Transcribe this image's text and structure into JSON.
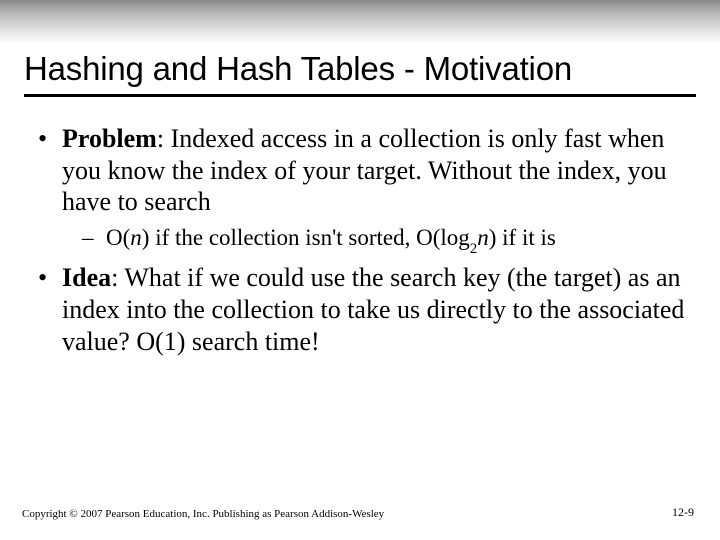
{
  "title": "Hashing and Hash Tables - Motivation",
  "bullets": {
    "b1": {
      "label": "Problem",
      "text": ": Indexed access in a collection is only fast when you know the index of your target. Without the index, you have to search"
    },
    "b1a": {
      "pre": "O(",
      "n1": "n",
      "mid": ") if the collection isn't sorted, O(log",
      "sub": "2",
      "n2": "n",
      "post": ") if it is"
    },
    "b2": {
      "label": "Idea",
      "text": ": What if we could use the search key (the target) as an index into the collection to take us directly to the associated value? O(1) search time!"
    }
  },
  "footer": "Copyright © 2007 Pearson Education, Inc. Publishing as Pearson Addison-Wesley",
  "pagenum": "12-9"
}
